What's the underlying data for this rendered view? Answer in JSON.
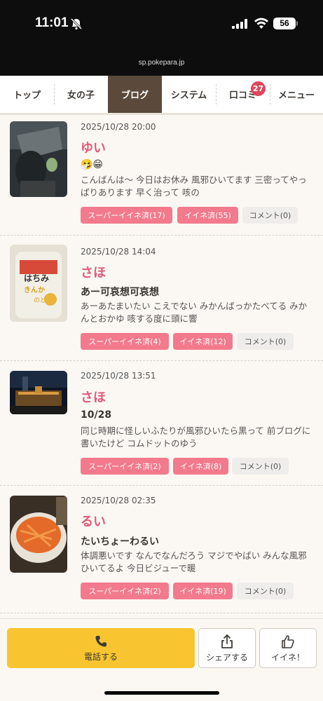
{
  "status_bar": {
    "time": "11:01",
    "battery": "56",
    "url": "sp.pokepara.jp"
  },
  "nav": {
    "tabs": [
      {
        "label": "トップ",
        "active": false
      },
      {
        "label": "女の子",
        "active": false
      },
      {
        "label": "ブログ",
        "active": true
      },
      {
        "label": "システム",
        "active": false
      },
      {
        "label": "口コミ",
        "active": false,
        "badge": "27"
      },
      {
        "label": "メニュー",
        "active": false
      }
    ]
  },
  "posts": [
    {
      "date": "2025/10/28 20:00",
      "name": "ゆい",
      "title": "🤧😁",
      "body": "こんばんは〜 今日はお休み 風邪ひいてます 三密ってやっぱりあります 早く治って 咳の",
      "super_like": "スーパーイイネ済(17)",
      "like": "イイネ済(55)",
      "comment": "コメント(0)"
    },
    {
      "date": "2025/10/28 14:04",
      "name": "さほ",
      "title": "あー可哀想可哀想",
      "body": "あーあたまいたい こえでない みかんばっかたべてる みかんとおかゆ 咳する度に頭に響",
      "super_like": "スーパーイイネ済(4)",
      "like": "イイネ済(12)",
      "comment": "コメント(0)",
      "thumb_text": "はちみ きんか のど"
    },
    {
      "date": "2025/10/28 13:51",
      "name": "さほ",
      "title": "10/28",
      "body": "同じ時期に怪しいふたりが風邪ひいたら黒って 前ブログに書いたけど コムドットのゆう",
      "super_like": "スーパーイイネ済(2)",
      "like": "イイネ済(8)",
      "comment": "コメント(0)"
    },
    {
      "date": "2025/10/28 02:35",
      "name": "るい",
      "title": "たいちょーわるい",
      "body": "体調悪いです なんでなんだろう マジでやばい みんな風邪ひいてるよ 今日ビジューで暖",
      "super_like": "スーパーイイネ済(2)",
      "like": "イイネ済(19)",
      "comment": "コメント(0)"
    }
  ],
  "bottom_bar": {
    "call": "電話する",
    "share": "シェアする",
    "like": "イイネ！"
  },
  "colors": {
    "accent_pink": "#e05a78",
    "button_pink": "#f27a8c",
    "call_yellow": "#f8c531",
    "active_tab": "#5b4a3b"
  }
}
